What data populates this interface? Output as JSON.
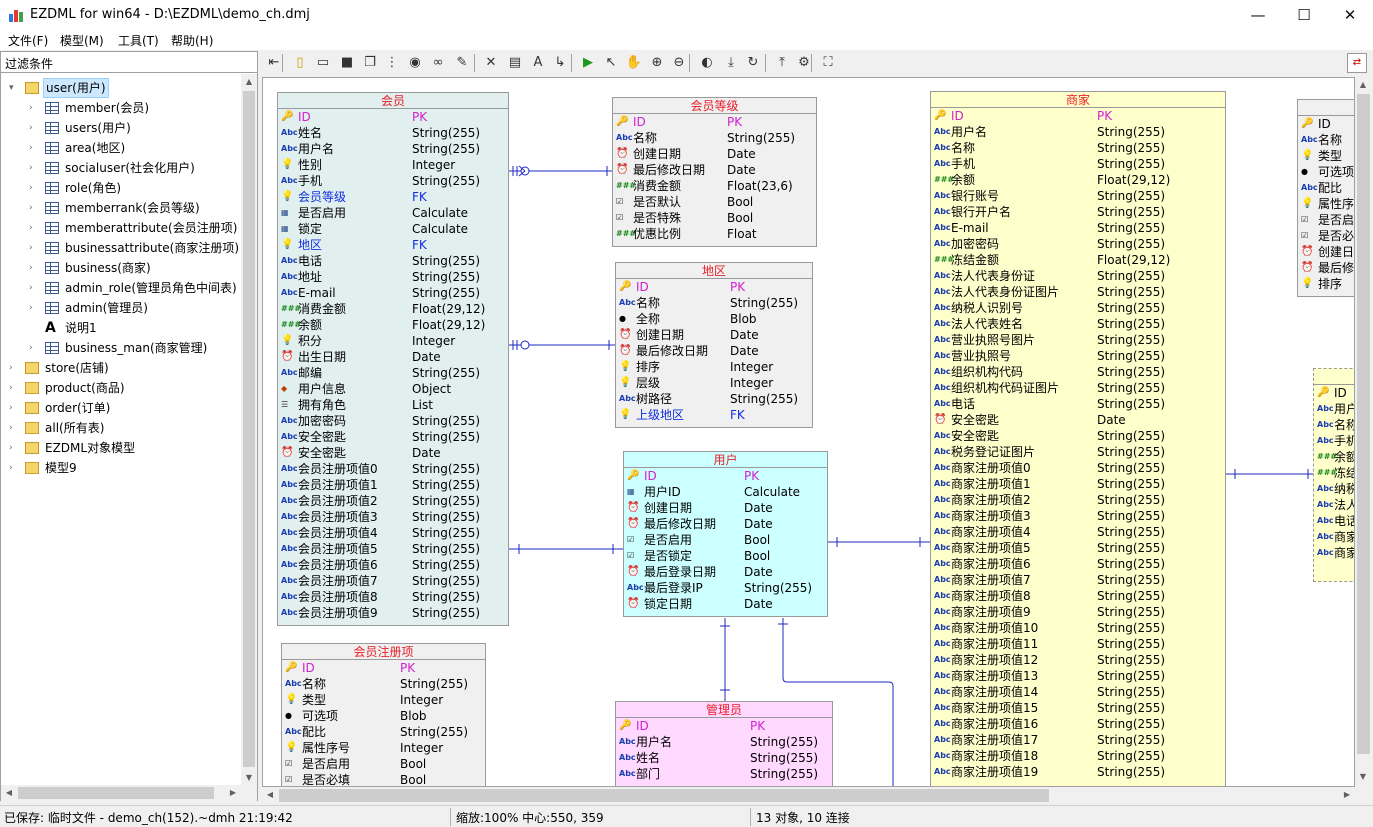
{
  "window": {
    "title": "EZDML for win64 - D:\\EZDML\\demo_ch.dmj",
    "minimize": "—",
    "maximize": "☐",
    "close": "✕"
  },
  "menu": [
    "文件(F)",
    "模型(M)",
    "工具(T)",
    "帮助(H)"
  ],
  "filter": {
    "label": "过滤条件"
  },
  "tree": [
    {
      "label": "user(用户)",
      "icon": "folder",
      "level": 0,
      "expanded": true,
      "selected": true
    },
    {
      "label": "member(会员)",
      "icon": "table",
      "level": 1
    },
    {
      "label": "users(用户)",
      "icon": "table",
      "level": 1
    },
    {
      "label": "area(地区)",
      "icon": "table",
      "level": 1
    },
    {
      "label": "socialuser(社会化用户)",
      "icon": "table",
      "level": 1
    },
    {
      "label": "role(角色)",
      "icon": "table",
      "level": 1
    },
    {
      "label": "memberrank(会员等级)",
      "icon": "table",
      "level": 1
    },
    {
      "label": "memberattribute(会员注册项)",
      "icon": "table",
      "level": 1
    },
    {
      "label": "businessattribute(商家注册项)",
      "icon": "table",
      "level": 1
    },
    {
      "label": "business(商家)",
      "icon": "table",
      "level": 1
    },
    {
      "label": "admin_role(管理员角色中间表)",
      "icon": "table",
      "level": 1
    },
    {
      "label": "admin(管理员)",
      "icon": "table",
      "level": 1
    },
    {
      "label": "说明1",
      "icon": "text",
      "level": 1
    },
    {
      "label": "business_man(商家管理)",
      "icon": "table",
      "level": 1
    },
    {
      "label": "store(店铺)",
      "icon": "folder",
      "level": 0
    },
    {
      "label": "product(商品)",
      "icon": "folder",
      "level": 0
    },
    {
      "label": "order(订单)",
      "icon": "folder",
      "level": 0
    },
    {
      "label": "all(所有表)",
      "icon": "folder",
      "level": 0
    },
    {
      "label": "EZDML对象模型",
      "icon": "folder",
      "level": 0
    },
    {
      "label": "模型9",
      "icon": "folder",
      "level": 0
    }
  ],
  "toolbar_icons": [
    "back-icon",
    "new-icon",
    "open-icon",
    "save-icon",
    "copy-icon",
    "tree-icon",
    "globe-icon",
    "binoculars-icon",
    "pen-icon",
    "delete-icon",
    "table-icon",
    "text-icon",
    "link-icon",
    "run-icon",
    "pointer-icon",
    "hand-icon",
    "zoom-in-icon",
    "zoom-out-icon",
    "eye-icon",
    "import-icon",
    "refresh-icon",
    "export-icon",
    "settings-icon",
    "fullscreen-icon"
  ],
  "entities": [
    {
      "id": "member",
      "title": "会员",
      "bg": "#e1efef",
      "fields": [
        [
          "key",
          "ID",
          "PK"
        ],
        [
          "abc",
          "姓名",
          "String(255)"
        ],
        [
          "abc",
          "用户名",
          "String(255)"
        ],
        [
          "bulb",
          "性别",
          "Integer"
        ],
        [
          "abc",
          "手机",
          "String(255)"
        ],
        [
          "bulb",
          "会员等级",
          "FK"
        ],
        [
          "calc",
          "是否启用",
          "Calculate"
        ],
        [
          "calc",
          "锁定",
          "Calculate"
        ],
        [
          "bulb",
          "地区",
          "FK"
        ],
        [
          "abc",
          "电话",
          "String(255)"
        ],
        [
          "abc",
          "地址",
          "String(255)"
        ],
        [
          "abc",
          "E-mail",
          "String(255)"
        ],
        [
          "num",
          "消费金额",
          "Float(29,12)"
        ],
        [
          "num",
          "余额",
          "Float(29,12)"
        ],
        [
          "bulb",
          "积分",
          "Integer"
        ],
        [
          "clock",
          "出生日期",
          "Date"
        ],
        [
          "abc",
          "邮编",
          "String(255)"
        ],
        [
          "obj",
          "用户信息",
          "Object"
        ],
        [
          "list",
          "拥有角色",
          "List"
        ],
        [
          "abc",
          "加密密码",
          "String(255)"
        ],
        [
          "abc",
          "安全密匙",
          "String(255)"
        ],
        [
          "clock",
          "安全密匙",
          "Date"
        ],
        [
          "abc",
          "会员注册项值0",
          "String(255)"
        ],
        [
          "abc",
          "会员注册项值1",
          "String(255)"
        ],
        [
          "abc",
          "会员注册项值2",
          "String(255)"
        ],
        [
          "abc",
          "会员注册项值3",
          "String(255)"
        ],
        [
          "abc",
          "会员注册项值4",
          "String(255)"
        ],
        [
          "abc",
          "会员注册项值5",
          "String(255)"
        ],
        [
          "abc",
          "会员注册项值6",
          "String(255)"
        ],
        [
          "abc",
          "会员注册项值7",
          "String(255)"
        ],
        [
          "abc",
          "会员注册项值8",
          "String(255)"
        ],
        [
          "abc",
          "会员注册项值9",
          "String(255)"
        ]
      ]
    },
    {
      "id": "memberrank",
      "title": "会员等级",
      "bg": "#f0f0f0",
      "fields": [
        [
          "key",
          "ID",
          "PK"
        ],
        [
          "abc",
          "名称",
          "String(255)"
        ],
        [
          "clock",
          "创建日期",
          "Date"
        ],
        [
          "clock",
          "最后修改日期",
          "Date"
        ],
        [
          "num",
          "消费金额",
          "Float(23,6)"
        ],
        [
          "check",
          "是否默认",
          "Bool"
        ],
        [
          "check",
          "是否特殊",
          "Bool"
        ],
        [
          "num",
          "优惠比例",
          "Float"
        ]
      ]
    },
    {
      "id": "area",
      "title": "地区",
      "bg": "#f0f0f0",
      "fields": [
        [
          "key",
          "ID",
          "PK"
        ],
        [
          "abc",
          "名称",
          "String(255)"
        ],
        [
          "dot",
          "全称",
          "Blob"
        ],
        [
          "clock",
          "创建日期",
          "Date"
        ],
        [
          "clock",
          "最后修改日期",
          "Date"
        ],
        [
          "bulb",
          "排序",
          "Integer"
        ],
        [
          "bulb",
          "层级",
          "Integer"
        ],
        [
          "abc",
          "树路径",
          "String(255)"
        ],
        [
          "bulb",
          "上级地区",
          "FK"
        ]
      ]
    },
    {
      "id": "users",
      "title": "用户",
      "bg": "#ccffff",
      "fields": [
        [
          "key",
          "ID",
          "PK"
        ],
        [
          "calc",
          "用户ID",
          "Calculate"
        ],
        [
          "clock",
          "创建日期",
          "Date"
        ],
        [
          "clock",
          "最后修改日期",
          "Date"
        ],
        [
          "check",
          "是否启用",
          "Bool"
        ],
        [
          "check",
          "是否锁定",
          "Bool"
        ],
        [
          "clock",
          "最后登录日期",
          "Date"
        ],
        [
          "abc",
          "最后登录IP",
          "String(255)"
        ],
        [
          "clock",
          "锁定日期",
          "Date"
        ]
      ]
    },
    {
      "id": "business",
      "title": "商家",
      "bg": "#ffffcc",
      "fields": [
        [
          "key",
          "ID",
          "PK"
        ],
        [
          "abc",
          "用户名",
          "String(255)"
        ],
        [
          "abc",
          "名称",
          "String(255)"
        ],
        [
          "abc",
          "手机",
          "String(255)"
        ],
        [
          "num",
          "余额",
          "Float(29,12)"
        ],
        [
          "abc",
          "银行账号",
          "String(255)"
        ],
        [
          "abc",
          "银行开户名",
          "String(255)"
        ],
        [
          "abc",
          "E-mail",
          "String(255)"
        ],
        [
          "abc",
          "加密密码",
          "String(255)"
        ],
        [
          "num",
          "冻结金额",
          "Float(29,12)"
        ],
        [
          "abc",
          "法人代表身份证",
          "String(255)"
        ],
        [
          "abc",
          "法人代表身份证图片",
          "String(255)"
        ],
        [
          "abc",
          "纳税人识别号",
          "String(255)"
        ],
        [
          "abc",
          "法人代表姓名",
          "String(255)"
        ],
        [
          "abc",
          "营业执照号图片",
          "String(255)"
        ],
        [
          "abc",
          "营业执照号",
          "String(255)"
        ],
        [
          "abc",
          "组织机构代码",
          "String(255)"
        ],
        [
          "abc",
          "组织机构代码证图片",
          "String(255)"
        ],
        [
          "abc",
          "电话",
          "String(255)"
        ],
        [
          "clock",
          "安全密匙",
          "Date"
        ],
        [
          "abc",
          "安全密匙",
          "String(255)"
        ],
        [
          "abc",
          "税务登记证图片",
          "String(255)"
        ],
        [
          "abc",
          "商家注册项值0",
          "String(255)"
        ],
        [
          "abc",
          "商家注册项值1",
          "String(255)"
        ],
        [
          "abc",
          "商家注册项值2",
          "String(255)"
        ],
        [
          "abc",
          "商家注册项值3",
          "String(255)"
        ],
        [
          "abc",
          "商家注册项值4",
          "String(255)"
        ],
        [
          "abc",
          "商家注册项值5",
          "String(255)"
        ],
        [
          "abc",
          "商家注册项值6",
          "String(255)"
        ],
        [
          "abc",
          "商家注册项值7",
          "String(255)"
        ],
        [
          "abc",
          "商家注册项值8",
          "String(255)"
        ],
        [
          "abc",
          "商家注册项值9",
          "String(255)"
        ],
        [
          "abc",
          "商家注册项值10",
          "String(255)"
        ],
        [
          "abc",
          "商家注册项值11",
          "String(255)"
        ],
        [
          "abc",
          "商家注册项值12",
          "String(255)"
        ],
        [
          "abc",
          "商家注册项值13",
          "String(255)"
        ],
        [
          "abc",
          "商家注册项值14",
          "String(255)"
        ],
        [
          "abc",
          "商家注册项值15",
          "String(255)"
        ],
        [
          "abc",
          "商家注册项值16",
          "String(255)"
        ],
        [
          "abc",
          "商家注册项值17",
          "String(255)"
        ],
        [
          "abc",
          "商家注册项值18",
          "String(255)"
        ],
        [
          "abc",
          "商家注册项值19",
          "String(255)"
        ]
      ]
    },
    {
      "id": "memberattribute",
      "title": "会员注册项",
      "bg": "#f0f0f0",
      "fields": [
        [
          "key",
          "ID",
          "PK"
        ],
        [
          "abc",
          "名称",
          "String(255)"
        ],
        [
          "bulb",
          "类型",
          "Integer"
        ],
        [
          "dot",
          "可选项",
          "Blob"
        ],
        [
          "abc",
          "配比",
          "String(255)"
        ],
        [
          "bulb",
          "属性序号",
          "Integer"
        ],
        [
          "check",
          "是否启用",
          "Bool"
        ],
        [
          "check",
          "是否必填",
          "Bool"
        ]
      ]
    },
    {
      "id": "admin",
      "title": "管理员",
      "bg": "#ffd9ff",
      "fields": [
        [
          "key",
          "ID",
          "PK"
        ],
        [
          "abc",
          "用户名",
          "String(255)"
        ],
        [
          "abc",
          "姓名",
          "String(255)"
        ],
        [
          "abc",
          "部门",
          "String(255)"
        ]
      ]
    },
    {
      "id": "businessattribute",
      "title": "",
      "bg": "#f0f0f0",
      "fields": [
        [
          "key",
          "ID",
          ""
        ],
        [
          "abc",
          "名称",
          ""
        ],
        [
          "bulb",
          "类型",
          ""
        ],
        [
          "dot",
          "可选项",
          ""
        ],
        [
          "abc",
          "配比",
          ""
        ],
        [
          "bulb",
          "属性序",
          ""
        ],
        [
          "check",
          "是否启",
          ""
        ],
        [
          "check",
          "是否必",
          ""
        ],
        [
          "clock",
          "创建日",
          ""
        ],
        [
          "clock",
          "最后修",
          ""
        ],
        [
          "bulb",
          "排序",
          ""
        ]
      ]
    },
    {
      "id": "business_man",
      "title": "",
      "bg": "#ffffcc",
      "fields": [
        [
          "key",
          "ID",
          ""
        ],
        [
          "abc",
          "用户",
          ""
        ],
        [
          "abc",
          "名称",
          ""
        ],
        [
          "abc",
          "手机",
          ""
        ],
        [
          "num",
          "余额",
          ""
        ],
        [
          "num",
          "冻结",
          ""
        ],
        [
          "abc",
          "纳税",
          ""
        ],
        [
          "abc",
          "法人",
          ""
        ],
        [
          "abc",
          "电话",
          ""
        ],
        [
          "abc",
          "商家",
          ""
        ],
        [
          "abc",
          "商家",
          ""
        ]
      ]
    }
  ],
  "status": {
    "saved": "已保存: 临时文件 - demo_ch(152).~dmh 21:19:42",
    "zoom": "缩放:100% 中心:550, 359",
    "count": "13 对象, 10 连接"
  }
}
